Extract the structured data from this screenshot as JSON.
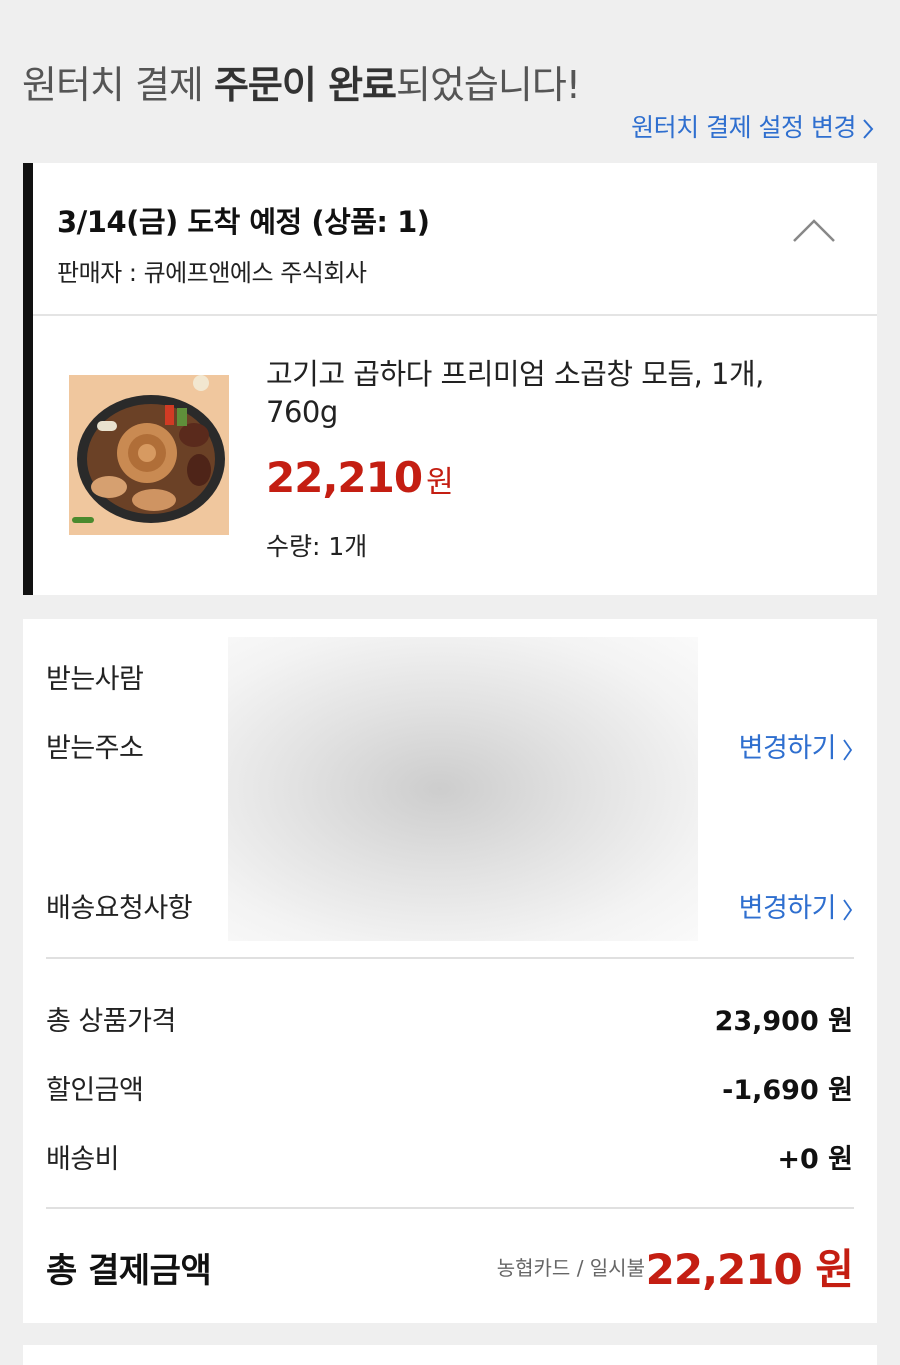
{
  "header": {
    "title_prefix": "원터치 결제 ",
    "title_bold": "주문이 완료",
    "title_suffix": "되었습니다!",
    "settings_link": "원터치 결제 설정 변경"
  },
  "shipment": {
    "arrival": "3/14(금) 도착 예정 (상품: 1)",
    "seller": "판매자 : 큐에프앤에스 주식회사",
    "product": {
      "name": "고기고 곱하다 프리미엄 소곱창 모듬, 1개, 760g",
      "price": "22,210",
      "currency": "원",
      "quantity": "수량: 1개"
    }
  },
  "delivery": {
    "recipient_label": "받는사람",
    "address_label": "받는주소",
    "request_label": "배송요청사항",
    "change_label": "변경하기"
  },
  "summary": {
    "rows": [
      {
        "label": "총 상품가격",
        "value": "23,900 원"
      },
      {
        "label": "할인금액",
        "value": "-1,690 원"
      },
      {
        "label": "배송비",
        "value": "+0 원"
      }
    ],
    "total_label": "총 결제금액",
    "payment_method": "농협카드 / 일시불",
    "total_value": "22,210 원"
  },
  "colors": {
    "accent_red": "#c41e12",
    "link_blue": "#2f6fcf",
    "background": "#efefef"
  }
}
